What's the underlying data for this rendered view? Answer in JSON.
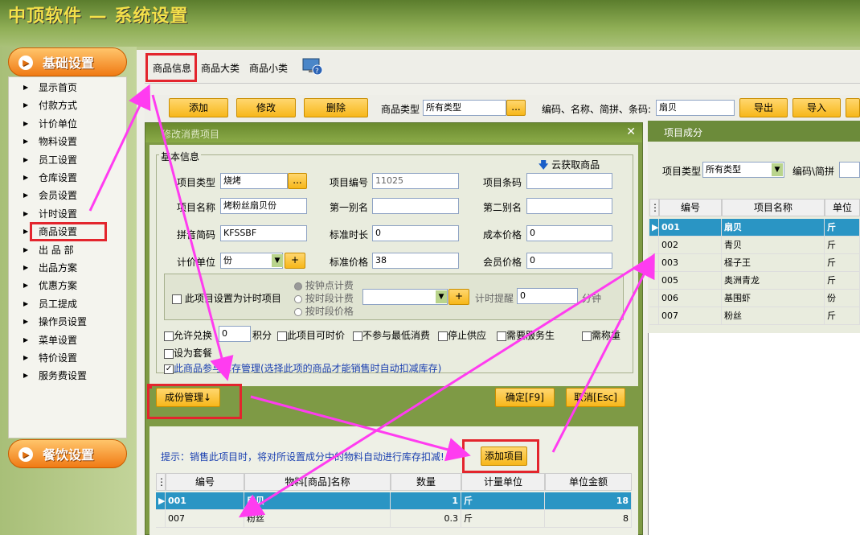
{
  "app": {
    "title": "中顶软件 — 系统设置"
  },
  "sidebar": {
    "basic_label": "基础设置",
    "catering_label": "餐饮设置",
    "items": [
      "显示首页",
      "付款方式",
      "计价单位",
      "物料设置",
      "员工设置",
      "仓库设置",
      "会员设置",
      "计时设置",
      "商品设置",
      "出 品 部",
      "出品方案",
      "优惠方案",
      "员工提成",
      "操作员设置",
      "菜单设置",
      "特价设置",
      "服务费设置"
    ],
    "active": "商品设置"
  },
  "tabs": [
    "商品信息",
    "商品大类",
    "商品小类"
  ],
  "toolbar": {
    "add": "添加",
    "edit": "修改",
    "delete": "删除",
    "type_label": "商品类型",
    "type_value": "所有类型",
    "more": "...",
    "search_label": "编码、名称、简拼、条码:",
    "search_value": "扇贝",
    "export": "导出",
    "import": "导入"
  },
  "dialog": {
    "title": "修改消费项目",
    "group_label": "基本信息",
    "cloud": "云获取商品",
    "fields": {
      "type_label": "项目类型",
      "type_value": "烧烤",
      "code_label": "项目编号",
      "code_value": "11025",
      "barcode_label": "项目条码",
      "barcode_value": "",
      "name_label": "项目名称",
      "name_value": "烤粉丝扇贝份",
      "alias1_label": "第一别名",
      "alias1_value": "",
      "alias2_label": "第二别名",
      "alias2_value": "",
      "pinyin_label": "拼音简码",
      "pinyin_value": "KFSSBF",
      "stdtime_label": "标准时长",
      "stdtime_value": "0",
      "cost_label": "成本价格",
      "cost_value": "0",
      "unit_label": "计价单位",
      "unit_value": "份",
      "stdprice_label": "标准价格",
      "stdprice_value": "38",
      "member_label": "会员价格",
      "member_value": "0"
    },
    "timer": {
      "check_label": "此项目设置为计时项目",
      "r1": "按钟点计费",
      "r2": "按时段计费",
      "r3": "按时段价格",
      "remind_label": "计时提醒",
      "remind_value": "0",
      "minute": "分钟"
    },
    "opts": {
      "exchange": "允许兑换",
      "exchange_value": "0",
      "points": "积分",
      "timeprice": "此项目可时价",
      "nomin": "不参与最低消费",
      "stop": "停止供应",
      "service": "需要服务生",
      "weigh": "需称重",
      "package": "设为套餐",
      "inventory": "此商品参与库存管理(选择此项的商品才能销售时自动扣减库存)"
    },
    "component_btn": "成份管理↓",
    "ok": "确定[F9]",
    "cancel": "取消[Esc]",
    "hint": "提示：销售此项目时，将对所设置成分中的物料自动进行库存扣减!",
    "add_item": "添加项目",
    "grid": {
      "headers": [
        "编号",
        "物料[商品]名称",
        "数量",
        "计量单位",
        "单位金额"
      ],
      "rows": [
        [
          "001",
          "扇贝",
          "1",
          "斤",
          "18"
        ],
        [
          "007",
          "粉丝",
          "0.3",
          "斤",
          "8"
        ]
      ]
    }
  },
  "right": {
    "title": "项目成分",
    "type_label": "项目类型",
    "type_value": "所有类型",
    "search_label": "编码\\简拼",
    "headers": [
      "编号",
      "项目名称",
      "单位"
    ],
    "rows": [
      [
        "001",
        "扇贝",
        "斤"
      ],
      [
        "002",
        "青贝",
        "斤"
      ],
      [
        "003",
        "柽子王",
        "斤"
      ],
      [
        "005",
        "奥洲青龙",
        "斤"
      ],
      [
        "006",
        "基围虾",
        "份"
      ],
      [
        "007",
        "粉丝",
        "斤"
      ]
    ]
  }
}
